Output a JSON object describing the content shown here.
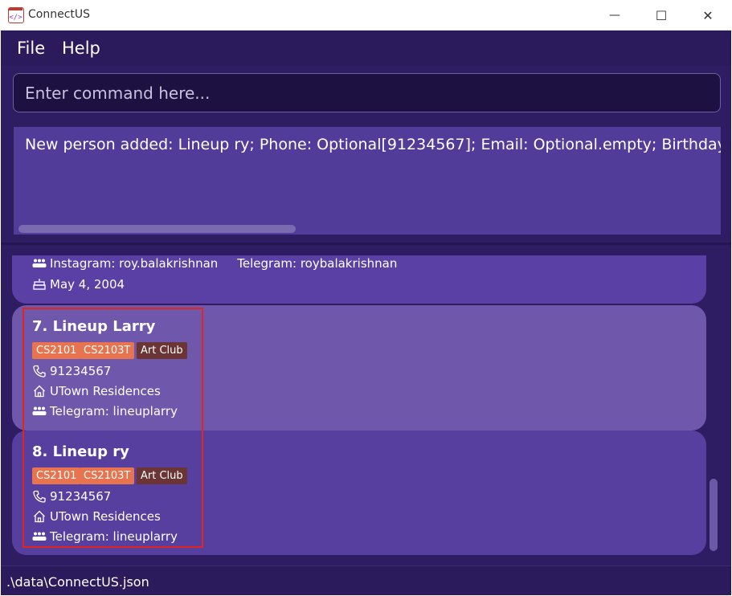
{
  "window": {
    "title": "ConnectUS",
    "minimize_glyph": "—",
    "maximize_glyph": "☐",
    "close_glyph": "✕"
  },
  "menu": {
    "file": "File",
    "help": "Help"
  },
  "command": {
    "placeholder": "Enter command here..."
  },
  "result": {
    "text": "New person added: Lineup ry; Phone: Optional[91234567]; Email: Optional.empty; Birthday: Optional.empty; Address: Optional[UTown Residences]"
  },
  "previous_card": {
    "instagram": "Instagram: roy.balakrishnan",
    "telegram": "Telegram: roybalakrishnan",
    "birthday": "May 4, 2004"
  },
  "persons": [
    {
      "index_name": "7.  Lineup Larry",
      "tags": [
        {
          "label": "CS2101",
          "color": "#e8734f"
        },
        {
          "label": "CS2103T",
          "color": "#e8734f"
        },
        {
          "label": "Art Club",
          "color": "#6b3535"
        }
      ],
      "phone": "91234567",
      "address": "UTown Residences",
      "telegram": "Telegram: lineuplarry"
    },
    {
      "index_name": "8.  Lineup ry",
      "tags": [
        {
          "label": "CS2101",
          "color": "#e8734f"
        },
        {
          "label": "CS2103T",
          "color": "#e8734f"
        },
        {
          "label": "Art Club",
          "color": "#6b3535"
        }
      ],
      "phone": "91234567",
      "address": "UTown Residences",
      "telegram": "Telegram: lineuplarry"
    }
  ],
  "status": {
    "path": ".\\data\\ConnectUS.json"
  },
  "icons": {
    "app": "code-icon",
    "phone": "phone-icon",
    "address": "home-icon",
    "social": "people-icon",
    "birthday": "cake-icon"
  },
  "colors": {
    "app_background": "#2e1d63",
    "card_highlight": "#6f57ac",
    "card_default": "#573f9f",
    "tag_module": "#e8734f",
    "tag_club": "#6b3535",
    "selection_border": "#e0241f"
  }
}
